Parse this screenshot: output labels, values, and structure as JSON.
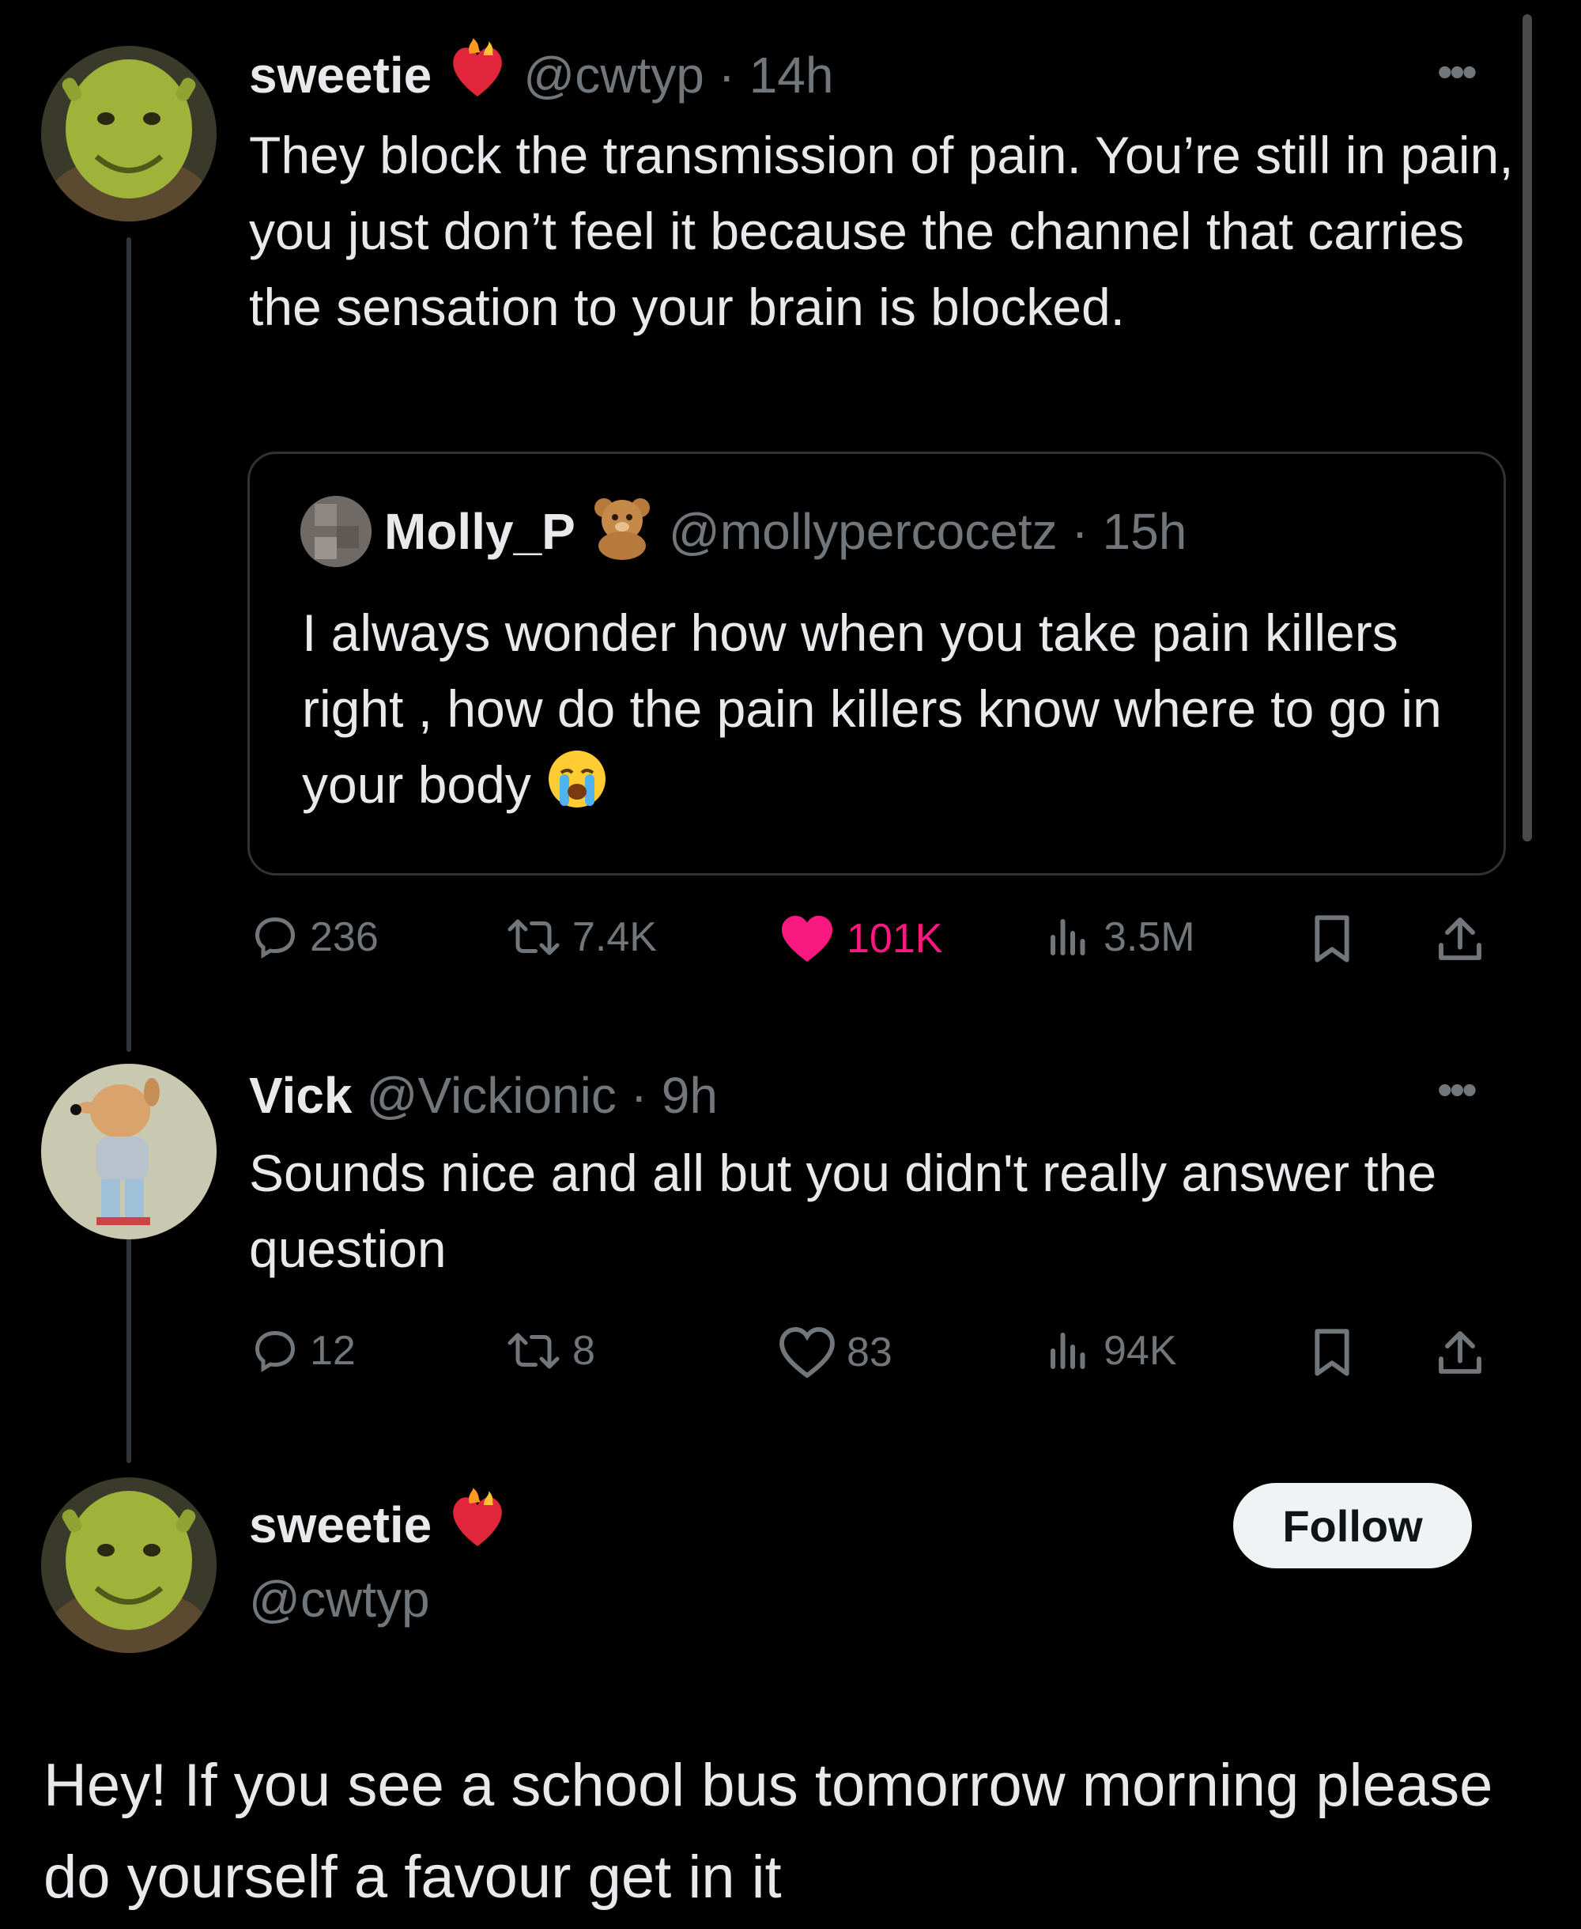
{
  "post1": {
    "name": "sweetie",
    "handle_time": "@cwtyp · 14h",
    "text": "They block the transmission of pain. You’re still in pain, you just don’t feel it because the channel that carries the sensation to your brain is blocked.",
    "quote": {
      "name": "Molly_P",
      "handle_time": "@mollypercocetz · 15h",
      "text": "I always wonder how when you take pain killers right , how do the pain killers know where to go in your body"
    },
    "actions": {
      "replies": "236",
      "reposts": "7.4K",
      "likes": "101K",
      "views": "3.5M"
    }
  },
  "post2": {
    "name": "Vick",
    "handle_time": "@Vickionic · 9h",
    "text": "Sounds nice and all but you didn't really answer the question",
    "actions": {
      "replies": "12",
      "reposts": "8",
      "likes": "83",
      "views": "94K"
    }
  },
  "post3": {
    "name": "sweetie",
    "handle": "@cwtyp",
    "follow_label": "Follow",
    "text": "Hey! If you see a school bus tomorrow morning please do yourself a favour get in it"
  },
  "colors": {
    "like_active": "#f91880",
    "muted": "#71767b",
    "text": "#e7e9ea"
  }
}
